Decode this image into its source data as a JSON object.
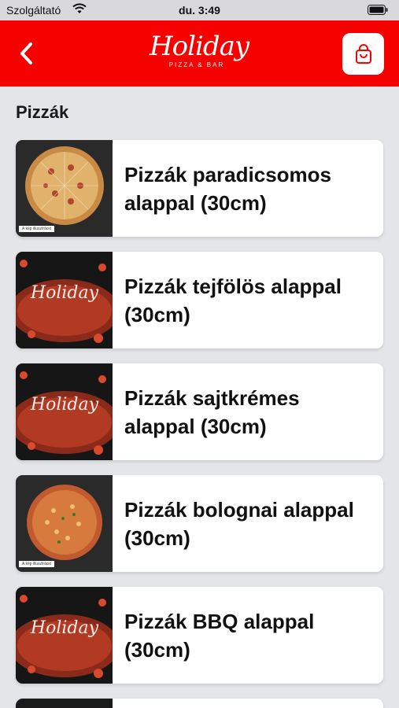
{
  "status_bar": {
    "carrier": "Szolgáltató",
    "time": "du. 3:49",
    "wifi_icon": "wifi-icon",
    "battery_icon": "battery-icon"
  },
  "header": {
    "background": "#f60000",
    "back_icon": "chevron-left-icon",
    "logo_script": "Holiday",
    "logo_sub": "PIZZA & BAR",
    "cart_icon": "shopping-bag-icon"
  },
  "section": {
    "title": "Pizzák"
  },
  "items": [
    {
      "title": "Pizzák paradicsomos alappal (30cm)",
      "thumb": "pizza-photo",
      "caption": "A kép illusztráció"
    },
    {
      "title": "Pizzák tejfölös alappal (30cm)",
      "thumb": "holiday-logo-pizza",
      "logo": "Holiday"
    },
    {
      "title": "Pizzák sajtkrémes alappal (30cm)",
      "thumb": "holiday-logo-pizza",
      "logo": "Holiday"
    },
    {
      "title": "Pizzák bolognai alappal (30cm)",
      "thumb": "pizza-photo",
      "caption": "A kép illusztráció"
    },
    {
      "title": "Pizzák BBQ alappal (30cm)",
      "thumb": "holiday-logo-pizza",
      "logo": "Holiday"
    }
  ]
}
